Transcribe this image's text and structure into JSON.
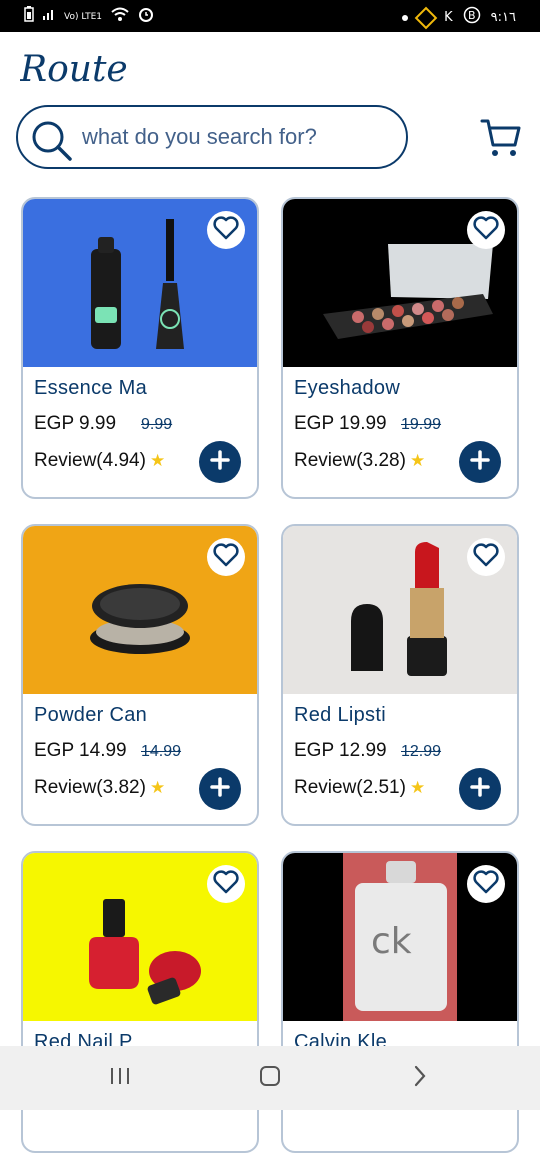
{
  "status_bar": {
    "carrier": "Vo) LTE1",
    "time": "٩:١٦",
    "icons": [
      "battery-icon",
      "signal-icon",
      "wifi-icon",
      "alarm-icon",
      "notification-dot-icon",
      "binance-icon",
      "k-icon",
      "b-icon"
    ]
  },
  "header": {
    "logo_text": "Route",
    "search_placeholder": "what do you search for?"
  },
  "colors": {
    "primary": "#0b3a6a",
    "card_border": "#b7c5d6",
    "star": "#f5c518"
  },
  "products": [
    {
      "title": "Essence Ma",
      "price": "EGP 9.99",
      "old_price": "9.99",
      "review": "Review(4.94)",
      "bg": "#3a6fe0"
    },
    {
      "title": "Eyeshadow",
      "price": "EGP 19.99",
      "old_price": "19.99",
      "review": "Review(3.28)",
      "bg": "#000000"
    },
    {
      "title": "Powder Can",
      "price": "EGP 14.99",
      "old_price": "14.99",
      "review": "Review(3.82)",
      "bg": "#f0a515"
    },
    {
      "title": "Red Lipsti",
      "price": "EGP 12.99",
      "old_price": "12.99",
      "review": "Review(2.51)",
      "bg": "#e6e4e2"
    },
    {
      "title": "Red Nail P",
      "price": "",
      "old_price": "",
      "review": "",
      "bg": "#f6f700"
    },
    {
      "title": "Calvin Kle",
      "price": "",
      "old_price": "",
      "review": "",
      "bg": "#000000"
    }
  ],
  "perfume_label": "ck"
}
